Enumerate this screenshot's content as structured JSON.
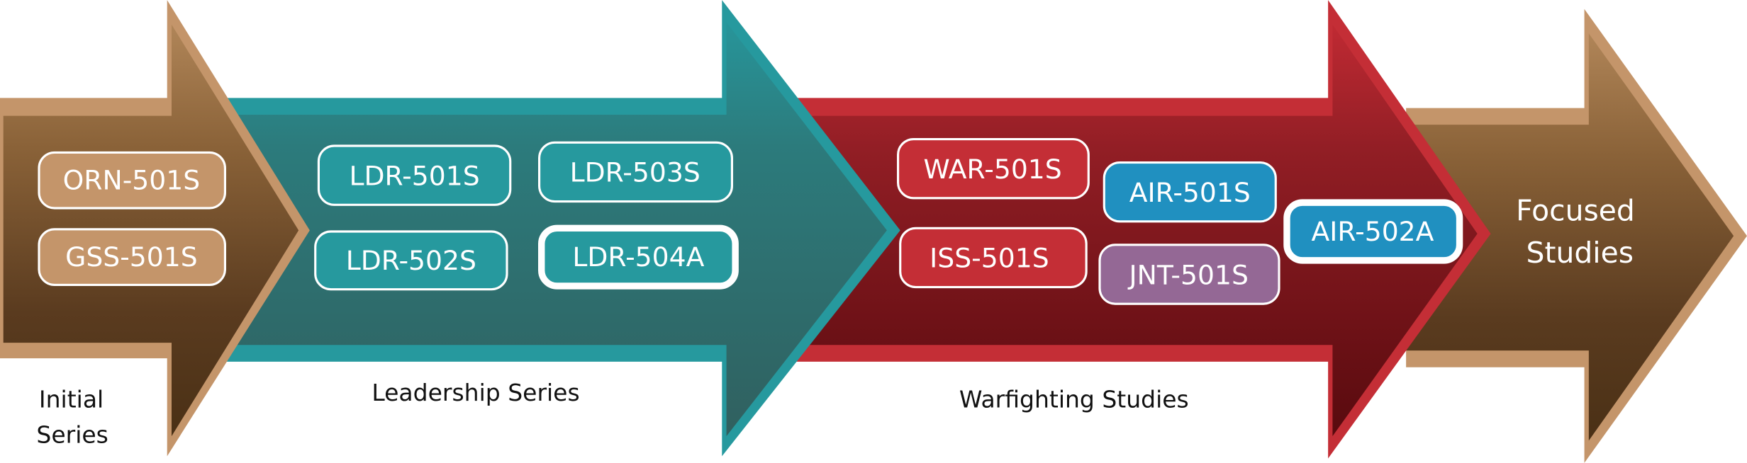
{
  "colors": {
    "tan": "#c4956a",
    "brown_top": "#93683f",
    "brown_bottom": "#4f3418",
    "teal": "#26999e",
    "teal_dark": "#2e6a6a",
    "red": "#c42e36",
    "red_dark": "#5e0c10",
    "blue": "#2090c0",
    "purple": "#946895"
  },
  "stages": [
    {
      "label_lines": [
        "Initial",
        "Series"
      ]
    },
    {
      "label": "Leadership Series"
    },
    {
      "label": "Warfighting Studies"
    },
    {
      "label_lines": [
        "Focused",
        "Studies"
      ]
    }
  ],
  "courses": {
    "orn501s": "ORN-501S",
    "gss501s": "GSS-501S",
    "ldr501s": "LDR-501S",
    "ldr503s": "LDR-503S",
    "ldr502s": "LDR-502S",
    "ldr504a": "LDR-504A",
    "war501s": "WAR-501S",
    "iss501s": "ISS-501S",
    "air501s": "AIR-501S",
    "jnt501s": "JNT-501S",
    "air502a": "AIR-502A"
  }
}
